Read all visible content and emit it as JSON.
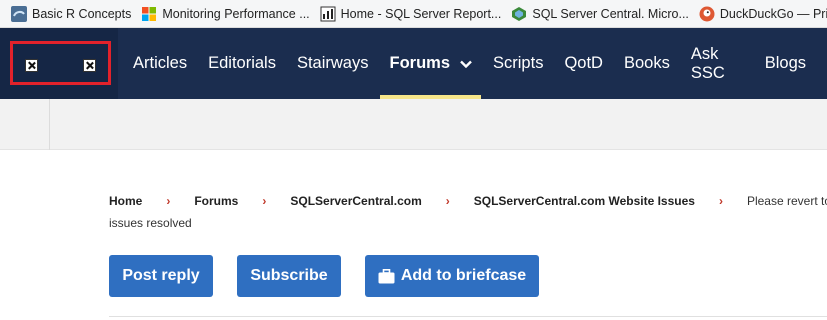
{
  "bookmarks": [
    {
      "label": "Basic R Concepts",
      "icon": "r-logo-icon"
    },
    {
      "label": "Monitoring Performance ...",
      "icon": "microsoft-logo-icon"
    },
    {
      "label": "Home - SQL Server Report...",
      "icon": "report-chart-icon"
    },
    {
      "label": "SQL Server Central. Micro...",
      "icon": "sqlservercentral-icon"
    },
    {
      "label": "DuckDuckGo — Privacy, s",
      "icon": "duckduckgo-icon"
    }
  ],
  "nav": {
    "items": [
      "Articles",
      "Editorials",
      "Stairways",
      "Forums",
      "Scripts",
      "QotD",
      "Books",
      "Ask SSC",
      "Blogs"
    ],
    "active": "Forums"
  },
  "breadcrumb": {
    "items": [
      "Home",
      "Forums",
      "SQLServerCentral.com",
      "SQLServerCentral.com Website Issues"
    ],
    "current_start": "Please revert to o",
    "current_end": "issues resolved"
  },
  "actions": {
    "post_reply": "Post reply",
    "subscribe": "Subscribe",
    "add_to_briefcase": "Add to briefcase"
  },
  "colors": {
    "nav_background": "#1b2d4f",
    "active_underline": "#f6e58a",
    "button": "#2f6fc1",
    "highlight_box": "#e2222b",
    "breadcrumb_separator": "#c0392b"
  }
}
